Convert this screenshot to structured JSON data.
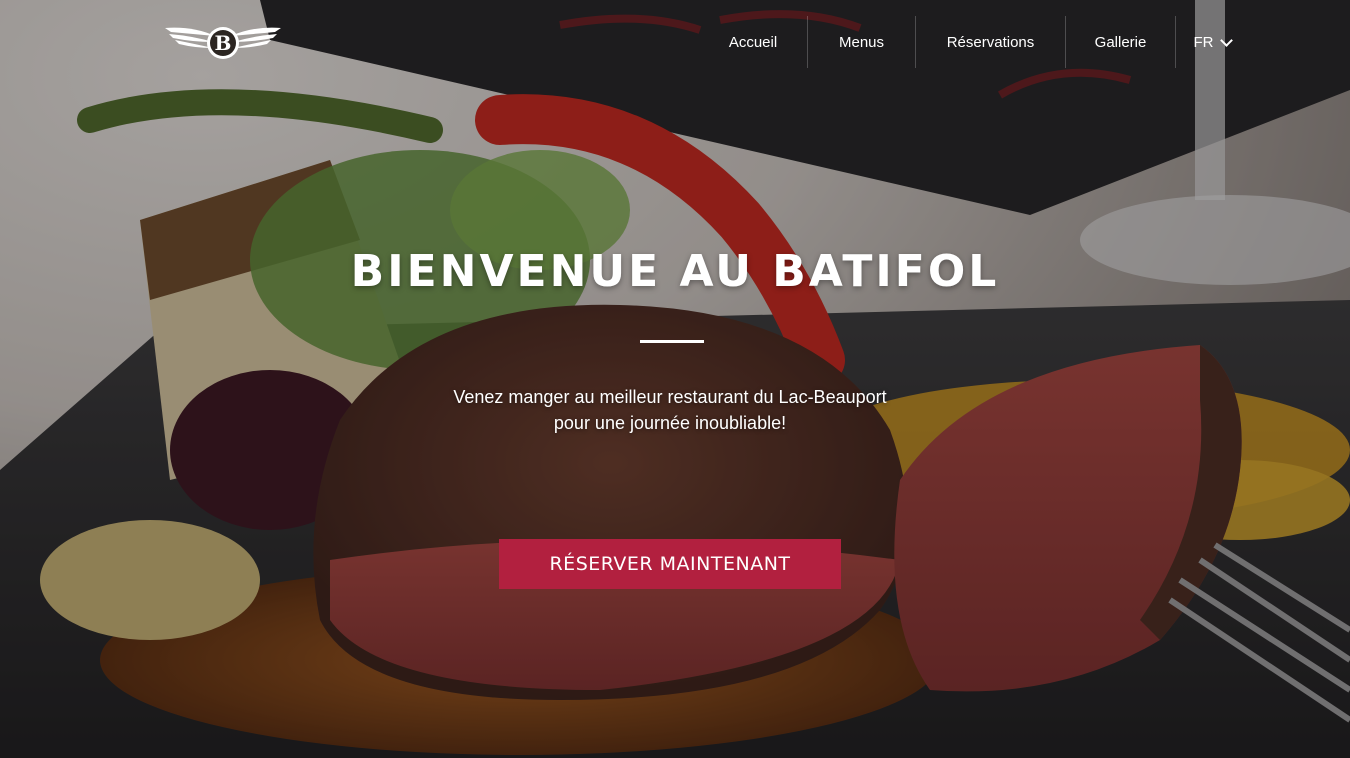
{
  "brand": {
    "logo_letter": "B"
  },
  "nav": {
    "items": [
      {
        "label": "Accueil"
      },
      {
        "label": "Menus"
      },
      {
        "label": "Réservations"
      },
      {
        "label": "Gallerie"
      }
    ],
    "language": "FR"
  },
  "hero": {
    "title": "BIENVENUE AU BATIFOL",
    "subtitle": "Venez manger au meilleur restaurant  du Lac-Beauport pour une journée inoubliable!",
    "cta_label": "RÉSERVER MAINTENANT"
  },
  "colors": {
    "accent": "#b2203f",
    "text": "#ffffff"
  }
}
